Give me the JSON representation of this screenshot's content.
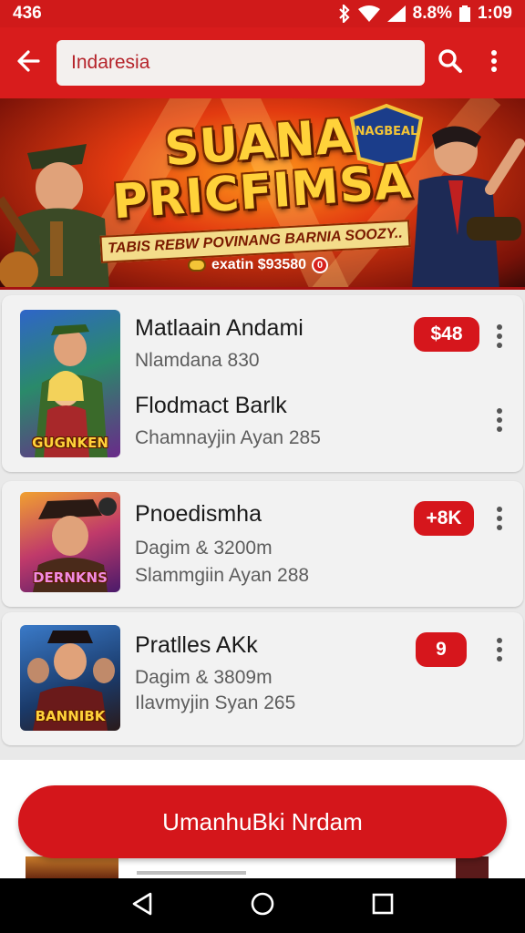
{
  "status_bar": {
    "left_text": "436",
    "battery": "8.8%",
    "time": "1:09"
  },
  "app_bar": {
    "search_value": "Indaresia"
  },
  "banner": {
    "title": "SUANA PRICFIMSA",
    "subtitle": "TABIS REBW POVINANG BARNIA SOOZY..",
    "promo_text": "exatin $93580"
  },
  "cards": [
    {
      "thumb_label": "GUGNKEN",
      "items": [
        {
          "title": "Matlaain Andami",
          "subtitle": "Nlamdana 830",
          "price": "$48"
        },
        {
          "title": "Flodmact Barlk",
          "subtitle": "Chamnayjin Ayan 285"
        }
      ]
    },
    {
      "thumb_label": "DERNKNS",
      "title": "Pnoedismha",
      "subtitle1": "Dagim & 3200m",
      "subtitle2": "Slammgiin Ayan 288",
      "price": "+8K"
    },
    {
      "thumb_label": "BANNIBK",
      "title": "Pratlles AKk",
      "subtitle1": "Dagim & 3809m",
      "subtitle2": "Ilavmyjin Syan 265",
      "price": "9"
    }
  ],
  "cta": {
    "label": "UmanhuBki Nrdam"
  },
  "colors": {
    "brand_red": "#d81c1c",
    "price_red": "#d6161c"
  },
  "icons": [
    "back-arrow-icon",
    "search-icon",
    "more-vert-icon",
    "nav-back-icon",
    "nav-home-icon",
    "nav-recents-icon"
  ]
}
